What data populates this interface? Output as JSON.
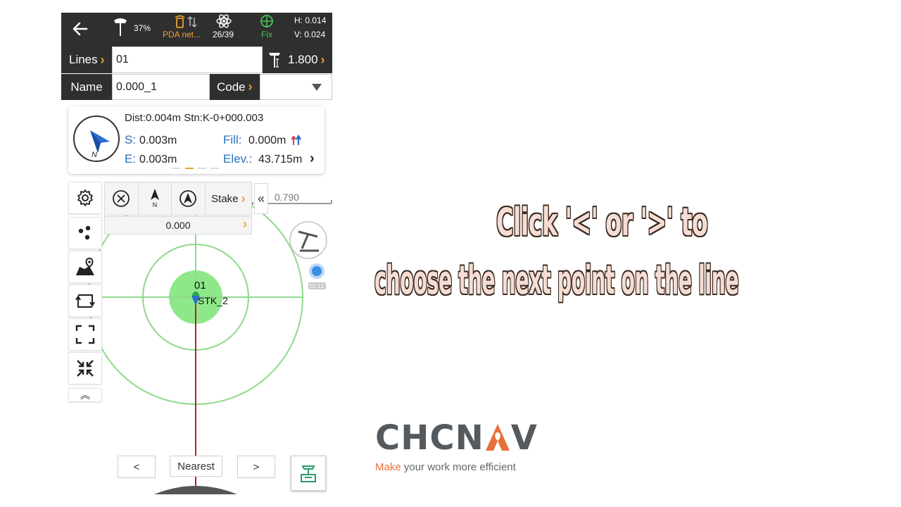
{
  "statusbar": {
    "battery": "37%",
    "network": "PDA net...",
    "satellites": "26/39",
    "fix": "Fix",
    "h_precision": "H: 0.014",
    "v_precision": "V: 0.024"
  },
  "lines_row": {
    "label": "Lines",
    "value": "01",
    "pole_height": "1.800"
  },
  "name_row": {
    "name_label": "Name",
    "name_value": "0.000_1",
    "code_label": "Code",
    "code_value": ""
  },
  "info": {
    "dist_line": "Dist:0.004m Stn:K-0+000.003",
    "s_label": "S:",
    "s_value": "0.003m",
    "e_label": "E:",
    "e_value": "0.003m",
    "fill_label": "Fill:",
    "fill_value": "0.000m",
    "elev_label": "Elev.:",
    "elev_value": "43.715m",
    "compass_n": "N"
  },
  "stake_bar": {
    "north_label": "N",
    "stake_label": "Stake",
    "distance": "0.000"
  },
  "map": {
    "scale_value": "0.790",
    "collapse_glyph": "«",
    "point_label": "01",
    "target_label": "STK_2",
    "timer": "01:12"
  },
  "nav": {
    "prev": "<",
    "nearest": "Nearest",
    "next": ">",
    "expand_glyph": "˄"
  },
  "overlay": {
    "line1": "Click '<' or '>' to",
    "line2": "choose the next point on the line"
  },
  "brand": {
    "logo_pre": "CHCN",
    "logo_post": "V",
    "tagline_make": "Make",
    "tagline_rest": " your work more efficient"
  },
  "colors": {
    "dark_bar": "#2f2f2f",
    "accent_orange": "#f0a030",
    "fix_green": "#4cbf5c",
    "label_blue": "#2a6fb8",
    "circle_green": "#8ee88a",
    "line_red": "#b52222"
  }
}
